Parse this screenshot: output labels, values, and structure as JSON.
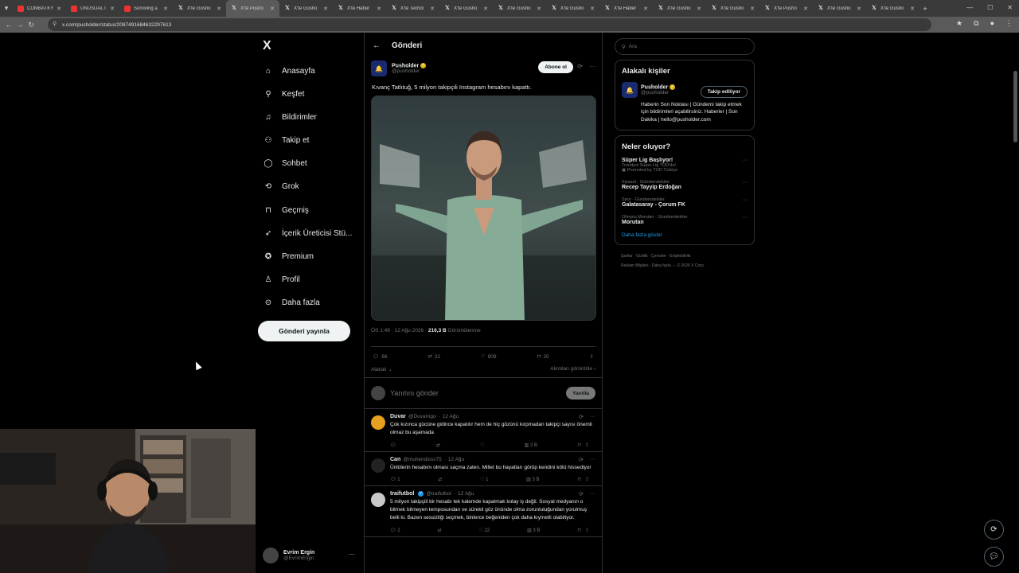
{
  "browser": {
    "tabs": [
      {
        "label": "COMBATKY",
        "icon": "youtube-icon"
      },
      {
        "label": "UNUSUAL I",
        "icon": "youtube-icon"
      },
      {
        "label": "Surviving a",
        "icon": "youtube-icon"
      },
      {
        "label": "X'te Gusho",
        "icon": "x-icon"
      },
      {
        "label": "X'te Pusho",
        "icon": "x-icon",
        "active": true
      },
      {
        "label": "X'te Gusho",
        "icon": "x-icon"
      },
      {
        "label": "X'te Haber",
        "icon": "x-icon"
      },
      {
        "label": "X'te Techol",
        "icon": "x-icon"
      },
      {
        "label": "X'te Gusho",
        "icon": "x-icon"
      },
      {
        "label": "X'te Gusho",
        "icon": "x-icon"
      },
      {
        "label": "X'te Gusho",
        "icon": "x-icon"
      },
      {
        "label": "X'te Haber",
        "icon": "x-icon"
      },
      {
        "label": "X'te Gusho",
        "icon": "x-icon"
      },
      {
        "label": "X'te Gusho",
        "icon": "x-icon"
      },
      {
        "label": "X'te Pusho",
        "icon": "x-icon"
      },
      {
        "label": "X'te Gusho",
        "icon": "x-icon"
      },
      {
        "label": "X'te Gusho",
        "icon": "x-icon"
      }
    ],
    "url": "x.com/pusholder/status/2087491684632297613"
  },
  "nav": {
    "logo": "X",
    "items": [
      {
        "label": "Anasayfa",
        "icon": "home-icon"
      },
      {
        "label": "Keşfet",
        "icon": "search-icon"
      },
      {
        "label": "Bildirimler",
        "icon": "bell-icon"
      },
      {
        "label": "Takip et",
        "icon": "person-plus-icon"
      },
      {
        "label": "Sohbet",
        "icon": "chat-icon"
      },
      {
        "label": "Grok",
        "icon": "grok-icon"
      },
      {
        "label": "Geçmiş",
        "icon": "bookmark-icon"
      },
      {
        "label": "İçerik Üreticisi Stü...",
        "icon": "rocket-icon"
      },
      {
        "label": "Premium",
        "icon": "premium-icon"
      },
      {
        "label": "Profil",
        "icon": "person-icon"
      },
      {
        "label": "Daha fazla",
        "icon": "more-circle-icon"
      }
    ],
    "post_button": "Gönderi yayınla",
    "user": {
      "name": "Evrim Ergin",
      "handle": "@EvrimErgin"
    }
  },
  "main": {
    "header": "Gönderi",
    "tweet": {
      "name": "Pusholder",
      "handle": "@pusholder",
      "subscribe": "Abone ol",
      "text": "Kıvanç Tatlıtuğ, 5 milyon takipçili Instagram hesabını kapattı.",
      "time": "ÖS 1:49 · 12 Ağu 2026 ·",
      "views": "216,3 B",
      "views_label": "Görüntülenme",
      "replies": "66",
      "reposts": "22",
      "likes": "909",
      "bookmarks": "20",
      "relevant": "Alakalı",
      "quotes": "Alıntıları görüntüle"
    },
    "reply_box": {
      "placeholder": "Yanıtını gönder",
      "button": "Yanıtla"
    },
    "comments": [
      {
        "name": "Duvar",
        "handle": "@Duvarngo",
        "date": "12 Ağu",
        "text": "Çok kızınca gücüne gidince kapatılır hem de hiç gözünü kırpmadan takipçi sayısı önemli olmaz bu aşamada",
        "replies": "",
        "reposts": "",
        "likes": "",
        "views": "2 B",
        "avatar_color": "#e8a020"
      },
      {
        "name": "Can",
        "handle": "@muhendisss75",
        "date": "12 Ağu",
        "text": "Ünlülerin hesabını olması saçma zaten. Millet bu hayatları görüp kendini kötü hissediyor",
        "replies": "1",
        "reposts": "",
        "likes": "1",
        "views": "3 B",
        "avatar_color": "#222222"
      },
      {
        "name": "traifutbol",
        "handle": "@traifutbol",
        "date": "12 Ağu",
        "text": "5 milyon takipçili bir hesabı tek kalemde kapatmak kolay iş değil. Sosyal medyanın o bitmek bilmeyen temposundan ve sürekli göz önünde olma zorunluluğundan yorulmuş belli ki. Bazen sessizliği seçmek, binlerce beğeniden çok daha kıymetli olabiliyor.",
        "replies": "2",
        "reposts": "",
        "likes": "22",
        "views": "3 B",
        "avatar_color": "#c9c9c9",
        "verified": true
      }
    ]
  },
  "right": {
    "search_placeholder": "Ara",
    "relevant_title": "Alakalı kişiler",
    "relevant_person": {
      "name": "Pusholder",
      "handle": "@pusholder",
      "button": "Takip ediliyor",
      "bio": "Haberin Son Noktası | Gündemi takip etmek için bildirimleri açabilirsiniz. Haberler | Son Dakika | hello@pusholder.com"
    },
    "trends_title": "Neler oluyor?",
    "trends": [
      {
        "context": "",
        "title": "Süper Lig Başlıyor!",
        "sub": "Trendyol Süper Lig TOD'da!",
        "promo": "Promoted by TOD Türkiye"
      },
      {
        "context": "Siyaset · Gündemdekiler",
        "title": "Recep Tayyip Erdoğan",
        "sub": "",
        "promo": ""
      },
      {
        "context": "Spor · Gündemdekiler",
        "title": "Galatasaray - Çorum FK",
        "sub": "",
        "promo": ""
      },
      {
        "context": "Olimpiu Morutan · Gündemdekiler",
        "title": "Morutan",
        "sub": "",
        "promo": ""
      }
    ],
    "show_more": "Daha fazla göster",
    "footer_line1": "Şartlar · Gizlilik · Çerezler · Erişilebilirlik ·",
    "footer_line2": "Reklam Bilgileri · Daha fazla ··· © 2026 X Corp."
  },
  "colors": {
    "accent": "#1d9bf0",
    "verified_gold": "#e2b719",
    "border": "#2f3336"
  }
}
